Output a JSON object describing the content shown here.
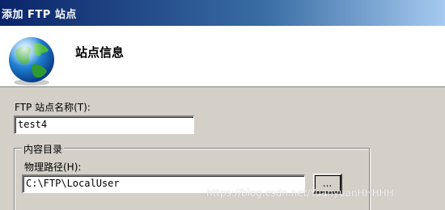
{
  "window": {
    "title": "添加 FTP 站点"
  },
  "header": {
    "title": "站点信息",
    "icon": "globe-icon"
  },
  "site_name": {
    "label": "FTP 站点名称(T):",
    "value": "test4"
  },
  "content_directory": {
    "legend": "内容目录",
    "path_label": "物理路径(H):",
    "path_value": "C:\\FTP\\LocalUser",
    "browse_label": "..."
  },
  "watermark": "https://blog.csdn.net/YuanyuanHHHHH"
}
